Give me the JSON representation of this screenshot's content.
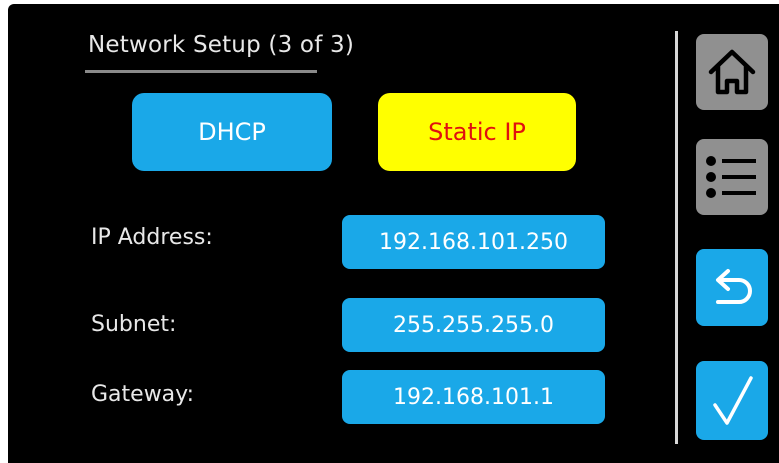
{
  "header": {
    "title": "Network Setup (3 of 3)"
  },
  "mode": {
    "dhcp_label": "DHCP",
    "static_label": "Static IP",
    "selected": "Static IP"
  },
  "fields": {
    "ip": {
      "label": "IP Address:",
      "value": "192.168.101.250"
    },
    "subnet": {
      "label": "Subnet:",
      "value": "255.255.255.0"
    },
    "gateway": {
      "label": "Gateway:",
      "value": "192.168.101.1"
    }
  },
  "sidebar": {
    "buttons": [
      "home-icon",
      "menu-icon",
      "back-icon",
      "checkmark-icon"
    ]
  },
  "colors": {
    "background": "#000000",
    "button_blue": "#1aa8e8",
    "selected_yellow": "#ffff00",
    "selected_text_red": "#e01010",
    "nav_gray": "#909090"
  }
}
